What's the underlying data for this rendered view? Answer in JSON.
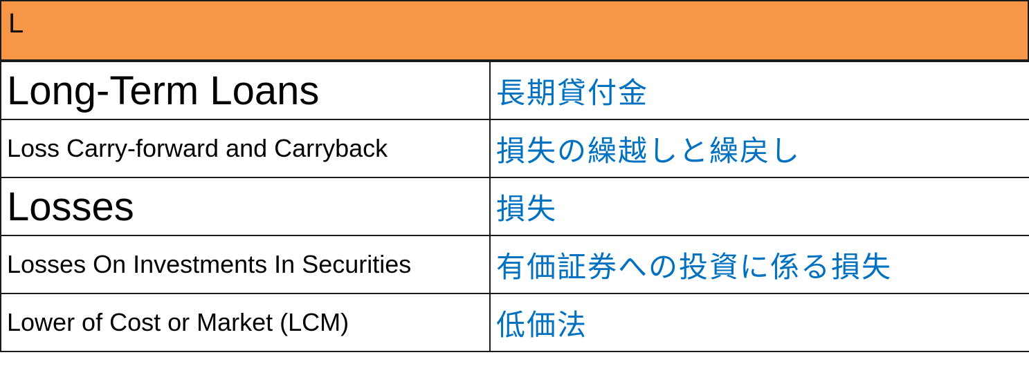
{
  "header": {
    "letter": "L"
  },
  "colors": {
    "header_bg": "#f79646",
    "japanese_text": "#0070c0",
    "english_text": "#000000"
  },
  "rows": [
    {
      "english": "Long-Term Loans",
      "japanese": "長期貸付金"
    },
    {
      "english": "Loss Carry-forward and Carryback",
      "japanese": "損失の繰越しと繰戻し"
    },
    {
      "english": "Losses",
      "japanese": "損失"
    },
    {
      "english": "Losses On Investments In Securities",
      "japanese": "有価証券への投資に係る損失"
    },
    {
      "english": "Lower of Cost or Market (LCM)",
      "japanese": "低価法"
    }
  ]
}
